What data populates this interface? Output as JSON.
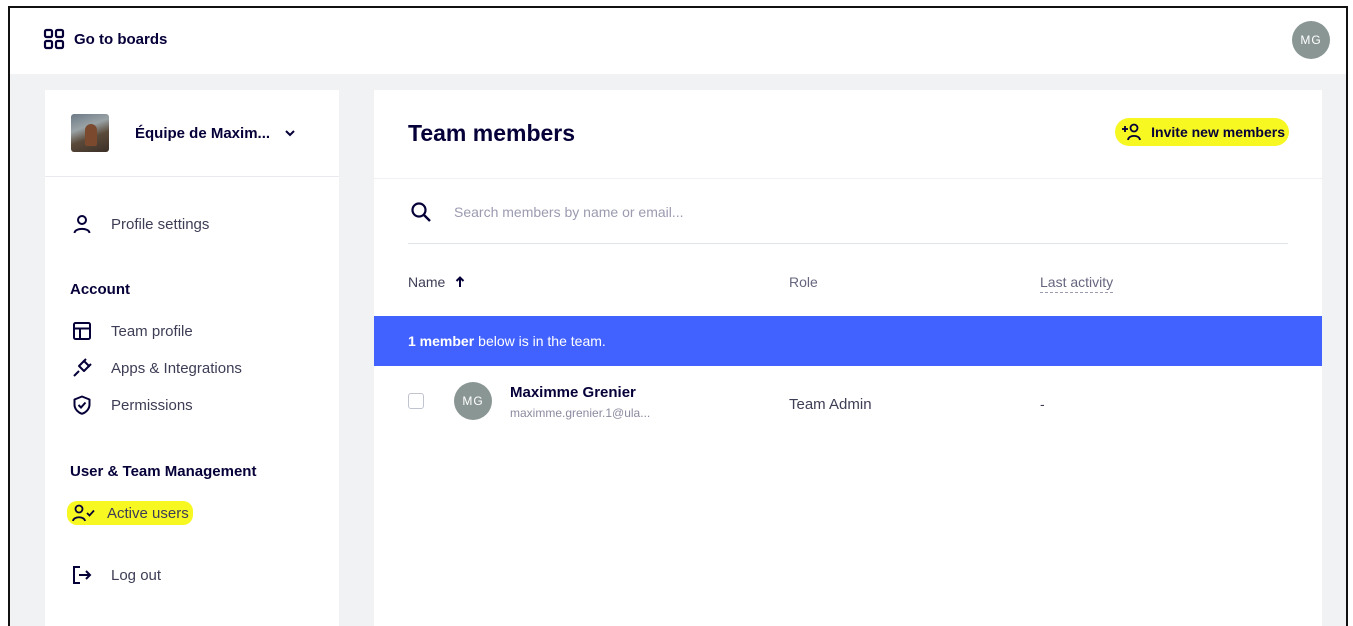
{
  "topbar": {
    "goto_label": "Go to boards",
    "user_initials": "MG"
  },
  "sidebar": {
    "team_name": "Équipe de Maxim...",
    "profile_settings": "Profile settings",
    "account_heading": "Account",
    "account_items": [
      "Team profile",
      "Apps & Integrations",
      "Permissions"
    ],
    "management_heading": "User & Team Management",
    "active_users": "Active users",
    "logout": "Log out"
  },
  "main": {
    "title": "Team members",
    "invite_label": "Invite new members",
    "search_placeholder": "Search members by name or email...",
    "columns": {
      "name": "Name",
      "role": "Role",
      "last_activity": "Last activity"
    },
    "banner": {
      "count_text": "1 member",
      "rest_text": "below is in the team."
    },
    "members": [
      {
        "initials": "MG",
        "name": "Maximme Grenier",
        "email": "maximme.grenier.1@ula...",
        "role": "Team Admin",
        "last_activity": "-"
      }
    ]
  },
  "colors": {
    "accent_blue": "#4262ff",
    "highlight_yellow": "#f7f722",
    "avatar_grey": "#8a9694",
    "text_dark": "#050038"
  }
}
